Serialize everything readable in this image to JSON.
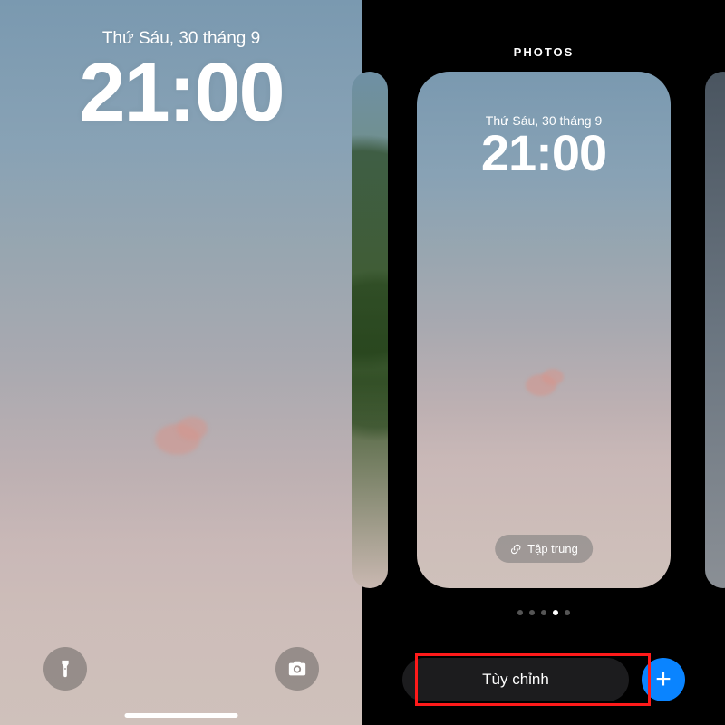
{
  "lockscreen": {
    "date": "Thứ Sáu, 30 tháng 9",
    "time": "21:00"
  },
  "gallery": {
    "title": "PHOTOS",
    "card": {
      "date": "Thứ Sáu, 30 tháng 9",
      "time": "21:00",
      "focus_label": "Tập trung"
    },
    "dots_total": 5,
    "dots_active_index": 3,
    "customize_label": "Tùy chỉnh",
    "add_label": "+"
  },
  "icons": {
    "flashlight": "flashlight-icon",
    "camera": "camera-icon",
    "link": "link-icon",
    "plus": "plus-icon"
  },
  "colors": {
    "accent_blue": "#0a84ff",
    "highlight_red": "#ff1a1a"
  }
}
